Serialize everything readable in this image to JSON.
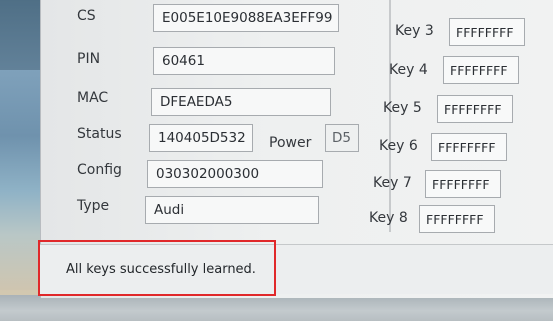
{
  "fields": {
    "cs": {
      "label": "CS",
      "value": "E005E10E9088EA3EFF99"
    },
    "pin": {
      "label": "PIN",
      "value": "60461"
    },
    "mac": {
      "label": "MAC",
      "value": "DFEAEDA5"
    },
    "status": {
      "label": "Status",
      "value": "140405D532"
    },
    "power": {
      "label": "Power",
      "value": "D5"
    },
    "config": {
      "label": "Config",
      "value": "030302000300"
    },
    "type": {
      "label": "Type",
      "value": "Audi"
    }
  },
  "keys": [
    {
      "label": "Key 3",
      "value": "FFFFFFFF"
    },
    {
      "label": "Key 4",
      "value": "FFFFFFFF"
    },
    {
      "label": "Key 5",
      "value": "FFFFFFFF"
    },
    {
      "label": "Key 6",
      "value": "FFFFFFFF"
    },
    {
      "label": "Key 7",
      "value": "FFFFFFFF"
    },
    {
      "label": "Key 8",
      "value": "FFFFFFFF"
    }
  ],
  "status_bar": {
    "message": "All keys successfully learned."
  },
  "colors": {
    "highlight": "#e0282a"
  }
}
